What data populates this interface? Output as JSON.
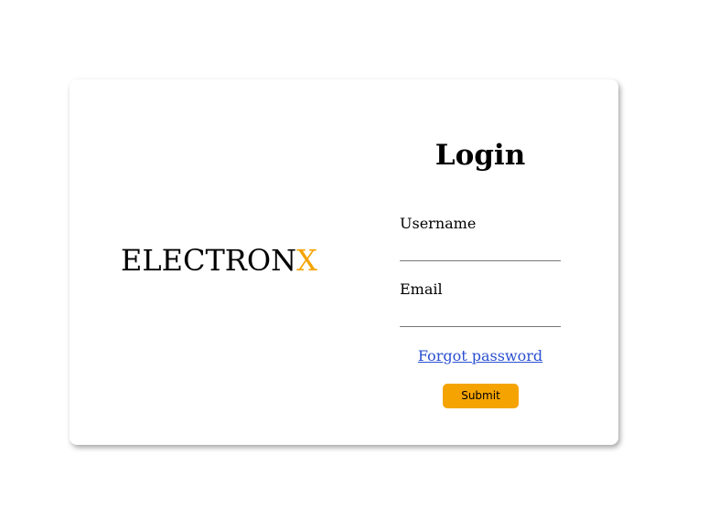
{
  "brand": {
    "name_main": "ELECTRON",
    "name_accent": "X",
    "accent_color": "#f5a300"
  },
  "login": {
    "title": "Login",
    "username_label": "Username",
    "username_value": "",
    "email_label": "Email",
    "email_value": "",
    "forgot_password": "Forgot password",
    "submit_label": "Submit"
  },
  "colors": {
    "button": "#f5a300",
    "link": "#2a4fd0"
  }
}
